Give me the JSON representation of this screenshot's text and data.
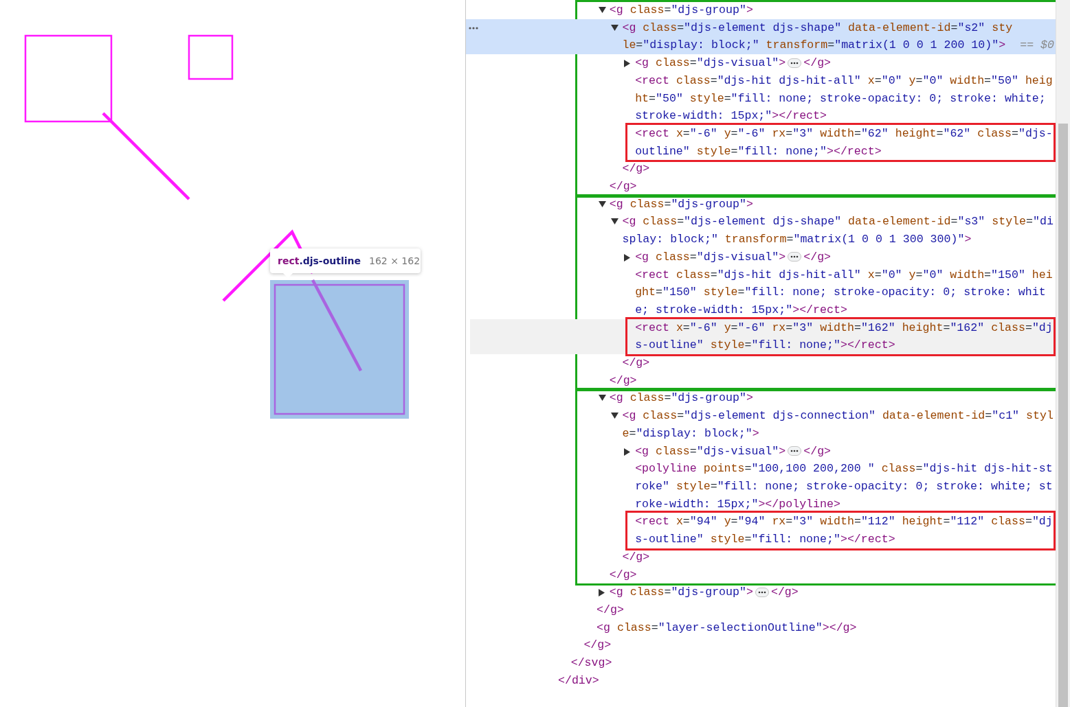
{
  "canvas": {
    "tooltip": {
      "tag": "rect",
      "class": ".djs-outline",
      "size": "162 × 162"
    }
  },
  "elements_tree": [
    {
      "kind": "closing",
      "close": "</div>",
      "children": [
        {
          "kind": "closing",
          "close": "</svg>",
          "children": [
            {
              "kind": "closing",
              "close": "</g>",
              "children": [
                {
                  "kind": "closing",
                  "close": "</g>",
                  "children": [
                    {
                      "kind": "branch",
                      "open": "<g class=\"djs-group\">",
                      "expanded": true,
                      "selected": false,
                      "hovered": false,
                      "color": "#1aa81a",
                      "close": "</g>",
                      "children": [
                        {
                          "kind": "branch",
                          "open": "<g class=\"djs-element djs-shape\" data-element-id=\"s2\" style=\"display: block;\" transform=\"matrix(1 0 0 1 200 10)\">",
                          "console_ref": "== $0",
                          "expanded": true,
                          "selected": true,
                          "hovered": false,
                          "close": "</g>",
                          "children": [
                            {
                              "kind": "branch",
                              "open": "<g class=\"djs-visual\">",
                              "expanded": false,
                              "selected": false,
                              "hovered": false,
                              "close": "</g>"
                            },
                            {
                              "kind": "leaf",
                              "open": "<rect class=\"djs-hit djs-hit-all\" x=\"0\" y=\"0\" width=\"50\" height=\"50\" style=\"fill: none; stroke-opacity: 0; stroke: white; stroke-width: 15px;\">",
                              "selected": false,
                              "hovered": false,
                              "close": "</rect>"
                            },
                            {
                              "kind": "leaf",
                              "open": "<rect x=\"-6\" y=\"-6\" rx=\"3\" width=\"62\" height=\"62\" class=\"djs-outline\" style=\"fill: none;\">",
                              "selected": false,
                              "hovered": false,
                              "color": "#e8202a",
                              "close": "</rect>"
                            }
                          ]
                        }
                      ]
                    },
                    {
                      "kind": "branch",
                      "open": "<g class=\"djs-group\">",
                      "expanded": true,
                      "selected": false,
                      "hovered": false,
                      "color": "#1aa81a",
                      "close": "</g>",
                      "children": [
                        {
                          "kind": "branch",
                          "open": "<g class=\"djs-element djs-shape\" data-element-id=\"s3\" style=\"display: block;\" transform=\"matrix(1 0 0 1 300 300)\">",
                          "expanded": true,
                          "selected": false,
                          "hovered": false,
                          "close": "</g>",
                          "children": [
                            {
                              "kind": "branch",
                              "open": "<g class=\"djs-visual\">",
                              "expanded": false,
                              "selected": false,
                              "hovered": false,
                              "close": "</g>"
                            },
                            {
                              "kind": "leaf",
                              "open": "<rect class=\"djs-hit djs-hit-all\" x=\"0\" y=\"0\" width=\"150\" height=\"150\" style=\"fill: none; stroke-opacity: 0; stroke: white; stroke-width: 15px;\">",
                              "selected": false,
                              "hovered": false,
                              "close": "</rect>"
                            },
                            {
                              "kind": "leaf",
                              "open": "<rect x=\"-6\" y=\"-6\" rx=\"3\" width=\"162\" height=\"162\" class=\"djs-outline\" style=\"fill: none;\">",
                              "selected": false,
                              "hovered": true,
                              "color": "#e8202a",
                              "close": "</rect>"
                            }
                          ]
                        }
                      ]
                    },
                    {
                      "kind": "branch",
                      "open": "<g class=\"djs-group\">",
                      "expanded": true,
                      "selected": false,
                      "hovered": false,
                      "color": "#1aa81a",
                      "close": "</g>",
                      "children": [
                        {
                          "kind": "branch",
                          "open": "<g class=\"djs-element djs-connection\" data-element-id=\"c1\" style=\"display: block;\">",
                          "expanded": true,
                          "selected": false,
                          "hovered": false,
                          "close": "</g>",
                          "children": [
                            {
                              "kind": "branch",
                              "open": "<g class=\"djs-visual\">",
                              "expanded": false,
                              "selected": false,
                              "hovered": false,
                              "close": "</g>"
                            },
                            {
                              "kind": "leaf",
                              "open": "<polyline points=\"100,100 200,200 \" class=\"djs-hit djs-hit-stroke\" style=\"fill: none; stroke-opacity: 0; stroke: white; stroke-width: 15px;\">",
                              "selected": false,
                              "hovered": false,
                              "close": "</polyline>"
                            },
                            {
                              "kind": "leaf",
                              "open": "<rect x=\"94\" y=\"94\" rx=\"3\" width=\"112\" height=\"112\" class=\"djs-outline\" style=\"fill: none;\">",
                              "selected": false,
                              "hovered": false,
                              "color": "#e8202a",
                              "close": "</rect>"
                            }
                          ]
                        }
                      ]
                    },
                    {
                      "kind": "branch",
                      "open": "<g class=\"djs-group\">",
                      "expanded": false,
                      "selected": false,
                      "hovered": false,
                      "close": "</g>"
                    }
                  ]
                },
                {
                  "kind": "leaf",
                  "open": "<g class=\"layer-selectionOutline\">",
                  "selected": false,
                  "hovered": false,
                  "close": "</g>"
                }
              ]
            }
          ]
        }
      ]
    }
  ]
}
